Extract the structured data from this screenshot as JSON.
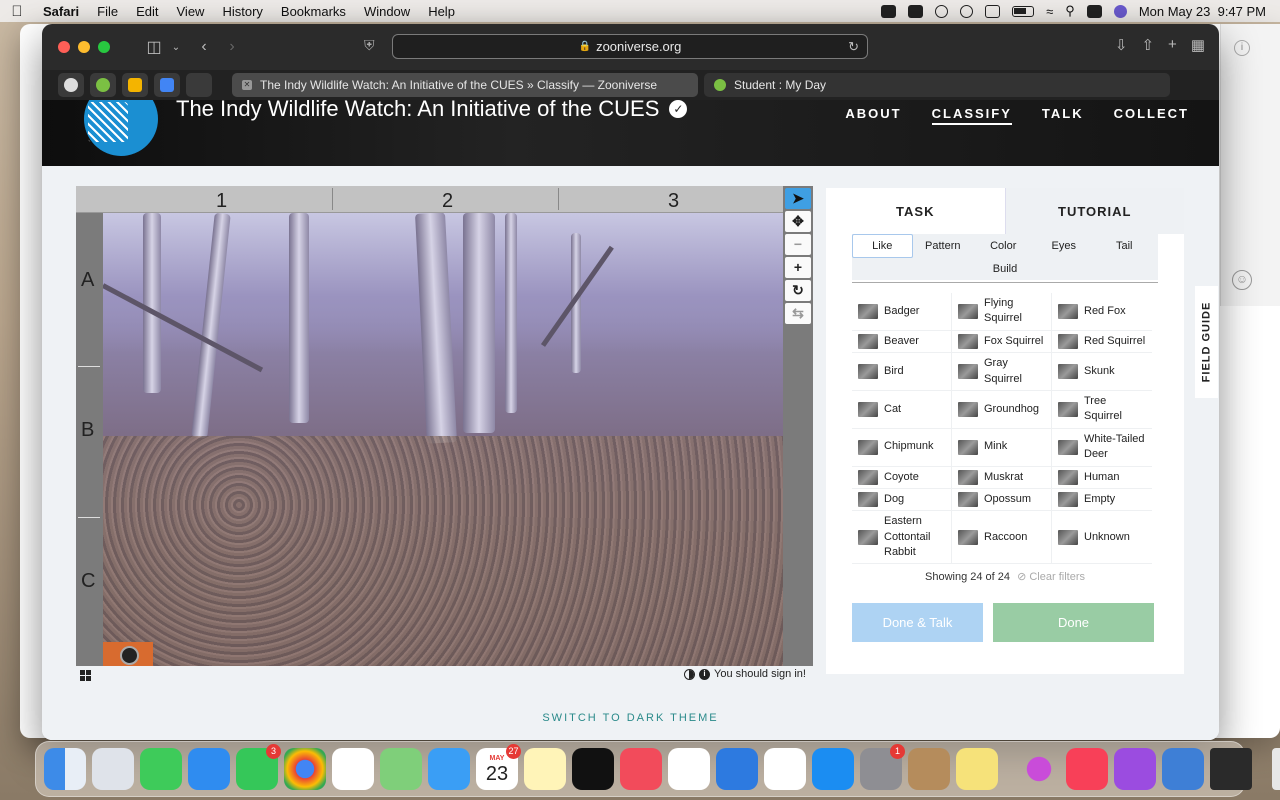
{
  "menubar": {
    "app": "Safari",
    "items": [
      "File",
      "Edit",
      "View",
      "History",
      "Bookmarks",
      "Window",
      "Help"
    ],
    "datetime": "Mon May 23  9:47 PM"
  },
  "browser": {
    "url": "zooniverse.org",
    "tabs": [
      {
        "title": "The Indy Wildlife Watch: An Initiative of the CUES » Classify — Zooniverse"
      },
      {
        "title": "Student : My Day"
      }
    ]
  },
  "site": {
    "title": "The Indy Wildlife Watch: An Initiative of the CUES",
    "nav": [
      "ABOUT",
      "CLASSIFY",
      "TALK",
      "COLLECT"
    ]
  },
  "viewer": {
    "cols": [
      "1",
      "2",
      "3"
    ],
    "rows": [
      "A",
      "B",
      "C"
    ],
    "sign_in": "You should sign in!"
  },
  "panel": {
    "tabs": [
      "TASK",
      "TUTORIAL"
    ],
    "filters": [
      "Like",
      "Pattern",
      "Color",
      "Eyes",
      "Tail",
      "Build"
    ],
    "species": [
      "Badger",
      "Flying Squirrel",
      "Red Fox",
      "Beaver",
      "Fox Squirrel",
      "Red Squirrel",
      "Bird",
      "Gray Squirrel",
      "Skunk",
      "Cat",
      "Groundhog",
      "Tree Squirrel",
      "Chipmunk",
      "Mink",
      "White-Tailed Deer",
      "Coyote",
      "Muskrat",
      "Human",
      "Dog",
      "Opossum",
      "Empty",
      "Eastern Cottontail Rabbit",
      "Raccoon",
      "Unknown"
    ],
    "showing": "Showing 24 of 24",
    "clear_filters": "Clear filters",
    "done_talk": "Done & Talk",
    "done": "Done"
  },
  "field_guide": "FIELD GUIDE",
  "switch_theme": "SWITCH TO DARK THEME",
  "dock": {
    "calendar_month": "MAY",
    "calendar_day": "23",
    "calendar_badge": "27",
    "facetime_badge": "3",
    "settings_badge": "1"
  }
}
